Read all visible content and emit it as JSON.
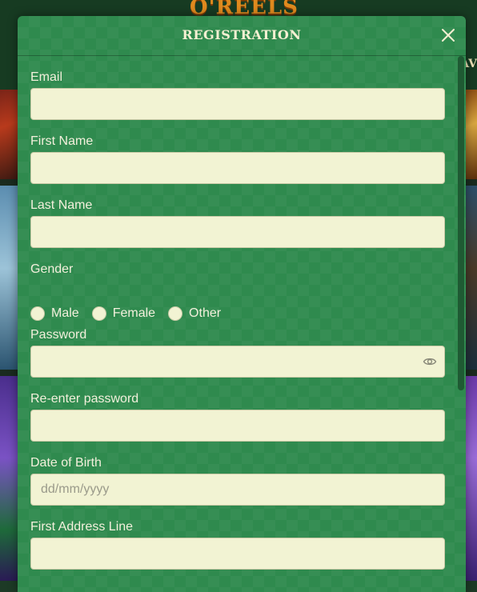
{
  "background": {
    "logo_text": "O'REELS",
    "nav_fragment": "AV"
  },
  "modal": {
    "title": "REGISTRATION",
    "close_icon": "close-icon"
  },
  "form": {
    "email": {
      "label": "Email",
      "value": "",
      "placeholder": ""
    },
    "first_name": {
      "label": "First Name",
      "value": "",
      "placeholder": ""
    },
    "last_name": {
      "label": "Last Name",
      "value": "",
      "placeholder": ""
    },
    "gender": {
      "label": "Gender",
      "options": [
        "Male",
        "Female",
        "Other"
      ],
      "selected": null
    },
    "password": {
      "label": "Password",
      "value": "",
      "placeholder": "",
      "toggle_icon": "eye-icon"
    },
    "reenter_password": {
      "label": "Re-enter password",
      "value": "",
      "placeholder": ""
    },
    "dob": {
      "label": "Date of Birth",
      "value": "",
      "placeholder": "dd/mm/yyyy"
    },
    "address1": {
      "label": "First Address Line",
      "value": "",
      "placeholder": ""
    }
  },
  "colors": {
    "modal_bg": "#2f8a4e",
    "input_bg": "#f2f3d3",
    "label_text": "#f3f0dc",
    "scrollbar": "#1f5a33"
  }
}
